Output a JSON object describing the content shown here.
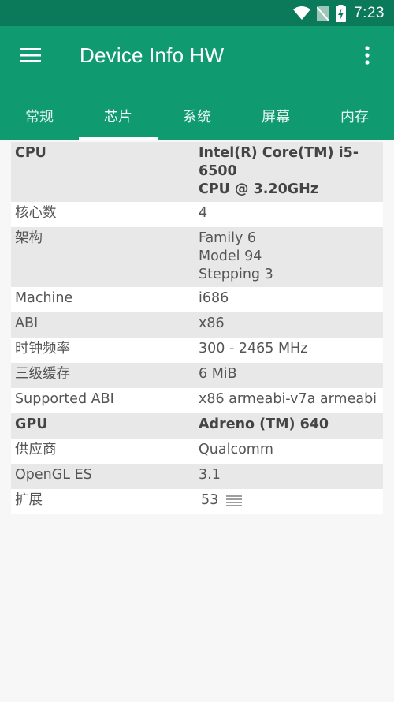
{
  "status_bar": {
    "time": "7:23",
    "icons": [
      "wifi-icon",
      "no-sim-icon",
      "battery-charging-icon"
    ]
  },
  "app_bar": {
    "title": "Device Info HW",
    "menu_icon": "hamburger-menu-icon",
    "overflow_icon": "more-vert-icon"
  },
  "tabs": [
    {
      "label": "常规"
    },
    {
      "label": "芯片"
    },
    {
      "label": "系统"
    },
    {
      "label": "屏幕"
    },
    {
      "label": "内存"
    }
  ],
  "active_tab": "芯片",
  "rows": [
    {
      "label": "CPU",
      "value": "Intel(R) Core(TM) i5-6500\nCPU @ 3.20GHz"
    },
    {
      "label": "核心数",
      "value": "4"
    },
    {
      "label": "架构",
      "value": "Family 6\nModel 94\nStepping 3"
    },
    {
      "label": "Machine",
      "value": "i686"
    },
    {
      "label": "ABI",
      "value": "x86"
    },
    {
      "label": "时钟频率",
      "value": "300 - 2465 MHz"
    },
    {
      "label": "三级缓存",
      "value": "6 MiB"
    },
    {
      "label": "Supported ABI",
      "value": "x86 armeabi-v7a armeabi"
    },
    {
      "label": "GPU",
      "value": "Adreno (TM) 640"
    },
    {
      "label": "供应商",
      "value": "Qualcomm"
    },
    {
      "label": "OpenGL ES",
      "value": "3.1"
    },
    {
      "label": "扩展",
      "value": "53"
    }
  ],
  "colors": {
    "status_bar": "#0b7a5b",
    "app_bar": "#0f9a70",
    "row_shaded": "#e8e8e8"
  }
}
